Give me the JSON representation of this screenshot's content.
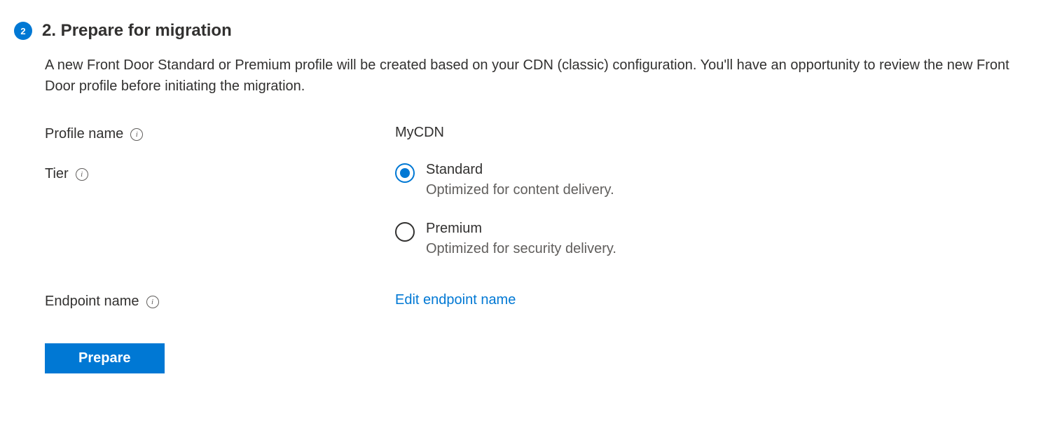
{
  "step": {
    "number": "2",
    "title": "2. Prepare for migration",
    "description": "A new Front Door Standard or Premium profile will be created based on your CDN (classic) configuration. You'll have an opportunity to review the new Front Door profile before initiating the migration."
  },
  "form": {
    "profileName": {
      "label": "Profile name",
      "value": "MyCDN"
    },
    "tier": {
      "label": "Tier",
      "options": [
        {
          "label": "Standard",
          "description": "Optimized for content delivery.",
          "selected": true
        },
        {
          "label": "Premium",
          "description": "Optimized for security delivery.",
          "selected": false
        }
      ]
    },
    "endpointName": {
      "label": "Endpoint name",
      "linkText": "Edit endpoint name"
    }
  },
  "actions": {
    "prepareButton": "Prepare"
  },
  "icons": {
    "info": "i"
  }
}
